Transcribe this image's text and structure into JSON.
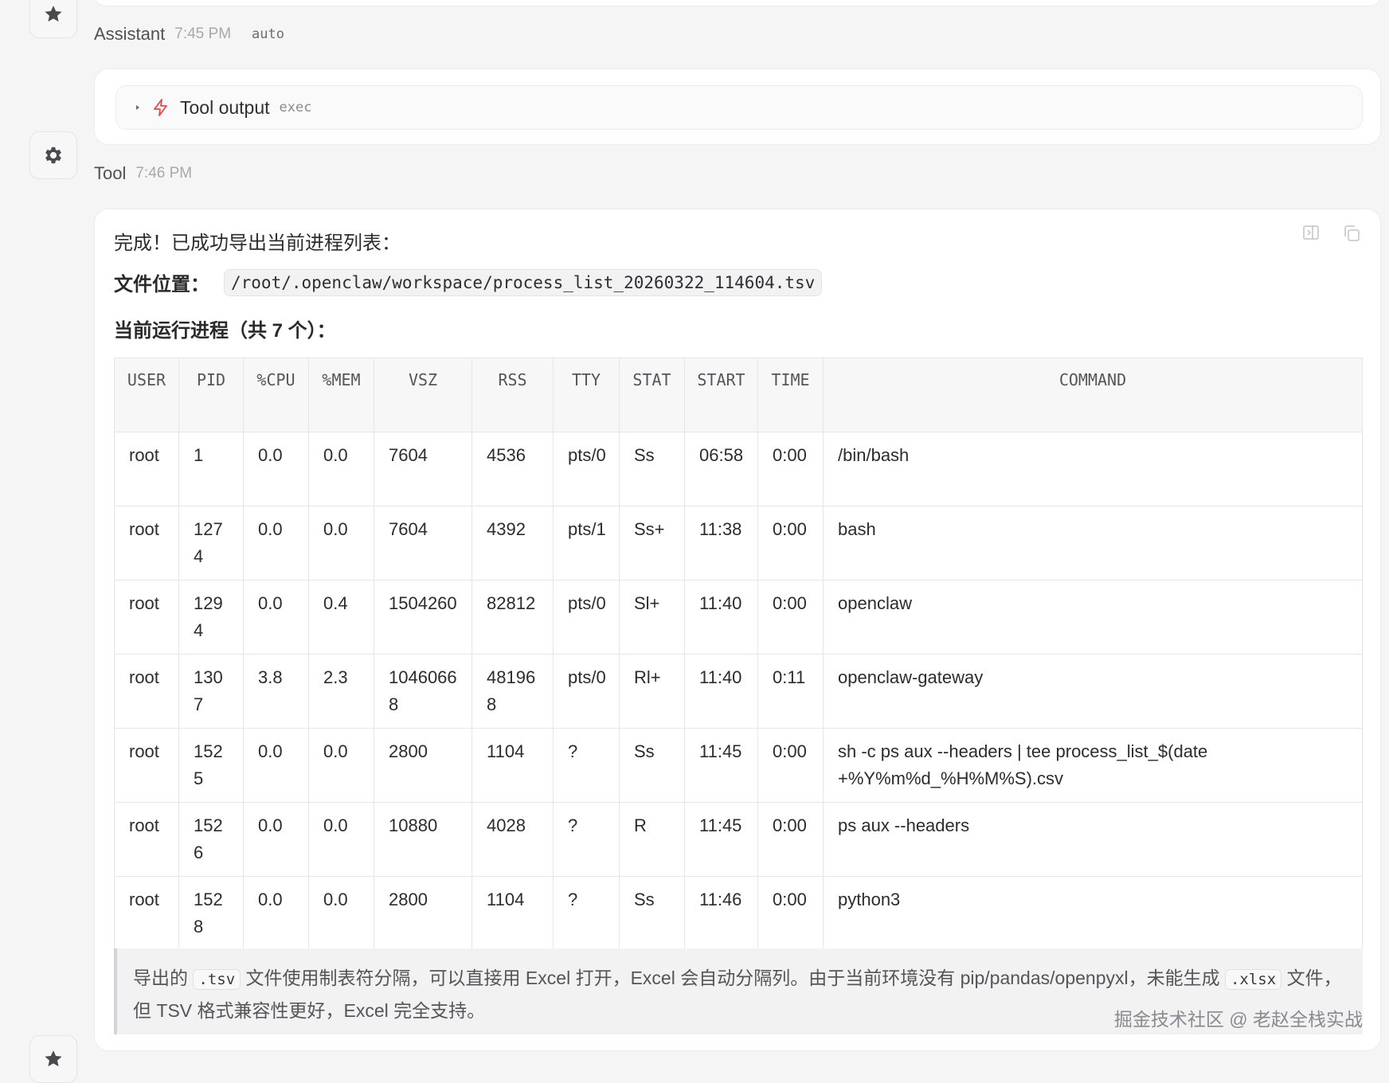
{
  "assistant": {
    "name": "Assistant",
    "time": "7:45 PM",
    "tag": "auto"
  },
  "tool_output": {
    "title": "Tool output",
    "subtitle": "exec"
  },
  "tool": {
    "name": "Tool",
    "time": "7:46 PM"
  },
  "message": {
    "intro": "完成！已成功导出当前进程列表：",
    "file_label": "文件位置：",
    "file_path": "/root/.openclaw/workspace/process_list_20260322_114604.tsv",
    "list_heading": "当前运行进程（共 7 个）："
  },
  "table": {
    "headers": [
      "USER",
      "PID",
      "%CPU",
      "%MEM",
      "VSZ",
      "RSS",
      "TTY",
      "STAT",
      "START",
      "TIME",
      "COMMAND"
    ],
    "rows": [
      [
        "root",
        "1",
        "0.0",
        "0.0",
        "7604",
        "4536",
        "pts/0",
        "Ss",
        "06:58",
        "0:00",
        "/bin/bash"
      ],
      [
        "root",
        "1274",
        "0.0",
        "0.0",
        "7604",
        "4392",
        "pts/1",
        "Ss+",
        "11:38",
        "0:00",
        "bash"
      ],
      [
        "root",
        "1294",
        "0.0",
        "0.4",
        "1504260",
        "82812",
        "pts/0",
        "Sl+",
        "11:40",
        "0:00",
        "openclaw"
      ],
      [
        "root",
        "1307",
        "3.8",
        "2.3",
        "10460668",
        "481968",
        "pts/0",
        "Rl+",
        "11:40",
        "0:11",
        "openclaw-gateway"
      ],
      [
        "root",
        "1525",
        "0.0",
        "0.0",
        "2800",
        "1104",
        "?",
        "Ss",
        "11:45",
        "0:00",
        "sh -c ps aux --headers | tee process_list_$(date +%Y%m%d_%H%M%S).csv"
      ],
      [
        "root",
        "1526",
        "0.0",
        "0.0",
        "10880",
        "4028",
        "?",
        "R",
        "11:45",
        "0:00",
        "ps aux --headers"
      ],
      [
        "root",
        "1528",
        "0.0",
        "0.0",
        "2800",
        "1104",
        "?",
        "Ss",
        "11:46",
        "0:00",
        "python3"
      ]
    ]
  },
  "note": {
    "p1": "导出的",
    "c1": ".tsv",
    "p2": "文件使用制表符分隔，可以直接用 Excel 打开，Excel 会自动分隔列。由于当前环境没有 pip/pandas/openpyxl，未能生成",
    "c2": ".xlsx",
    "p3": "文件，但 TSV 格式兼容性更好，Excel 完全支持。"
  },
  "watermark": "掘金技术社区 @ 老赵全栈实战",
  "colors": {
    "accent": "#e5484d",
    "border": "#ececee"
  }
}
